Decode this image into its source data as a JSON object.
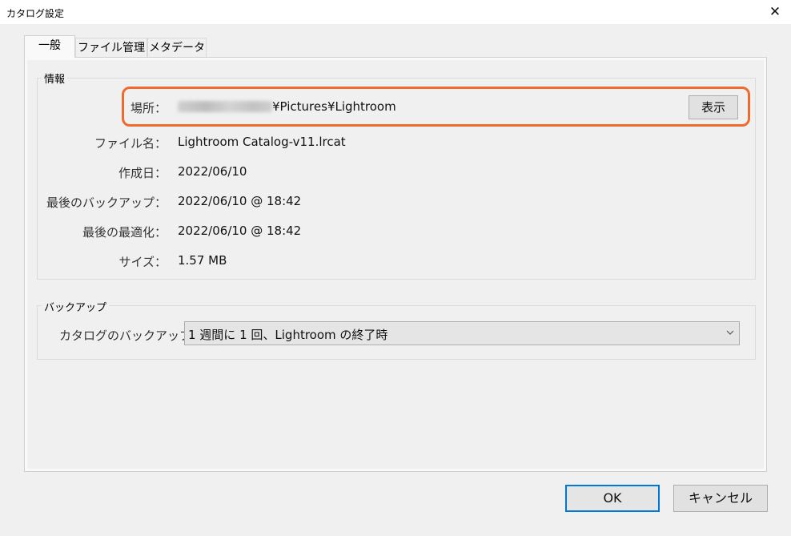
{
  "window": {
    "title": "カタログ設定",
    "close_glyph": "✕"
  },
  "tabs": [
    {
      "label": "一般",
      "active": true
    },
    {
      "label": "ファイル管理",
      "active": false
    },
    {
      "label": "メタデータ",
      "active": false
    }
  ],
  "info": {
    "group_label": "情報",
    "location": {
      "label": "場所：",
      "value_suffix": "¥Pictures¥Lightroom",
      "show_button": "表示"
    },
    "filename": {
      "label": "ファイル名：",
      "value": "Lightroom Catalog-v11.lrcat"
    },
    "created": {
      "label": "作成日：",
      "value": "2022/06/10"
    },
    "last_backup": {
      "label": "最後のバックアップ：",
      "value": "2022/06/10 @ 18:42"
    },
    "last_optimized": {
      "label": "最後の最適化：",
      "value": "2022/06/10 @ 18:42"
    },
    "size": {
      "label": "サイズ：",
      "value": "1.57 MB"
    }
  },
  "backup": {
    "group_label": "バックアップ",
    "label": "カタログのバックアップ：",
    "selected": "1 週間に 1 回、Lightroom の終了時"
  },
  "footer": {
    "ok_label": "OK",
    "cancel_label": "キャンセル"
  },
  "colors": {
    "highlight": "#f06a2e",
    "default_button_border": "#0078d7"
  },
  "icons": [
    "close-icon",
    "chevron-down-icon"
  ]
}
